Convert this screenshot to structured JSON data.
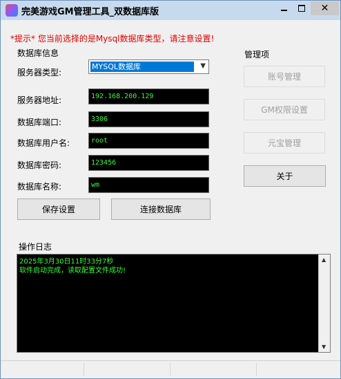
{
  "window": {
    "title": "完美游戏GM管理工具_双数据库版",
    "controls": {
      "minimize_icon": "minimize-icon",
      "maximize_icon": "maximize-icon",
      "close_label": "✕"
    }
  },
  "tip": "*提示*  您当前选择的是Mysql数据库类型，请注意设置!",
  "db_group": {
    "title": "数据库信息",
    "fields": {
      "server_type": {
        "label": "服务器类型:",
        "value": "MYSQL数据库"
      },
      "server_addr": {
        "label": "服务器地址:",
        "value": "192.168.200.129"
      },
      "db_port": {
        "label": "数据库端口:",
        "value": "3306"
      },
      "db_user": {
        "label": "数据库用户名:",
        "value": "root"
      },
      "db_password": {
        "label": "数据库密码:",
        "value": "123456"
      },
      "db_name": {
        "label": "数据库名称:",
        "value": "wm"
      }
    },
    "buttons": {
      "save": "保存设置",
      "connect": "连接数据库"
    }
  },
  "manage_group": {
    "title": "管理项",
    "buttons": {
      "account": "账号管理",
      "gm_perm": "GM权限设置",
      "gold": "元宝管理",
      "about": "关于"
    }
  },
  "log": {
    "title": "操作日志",
    "lines": [
      "2025年3月30日11时33分7秒",
      "软件启动完成，读取配置文件成功!"
    ]
  },
  "colors": {
    "tip": "#e00000",
    "console_text": "#33ff33",
    "console_bg": "#000000",
    "titlebar": "#c7daed",
    "selection": "#0078d7"
  }
}
